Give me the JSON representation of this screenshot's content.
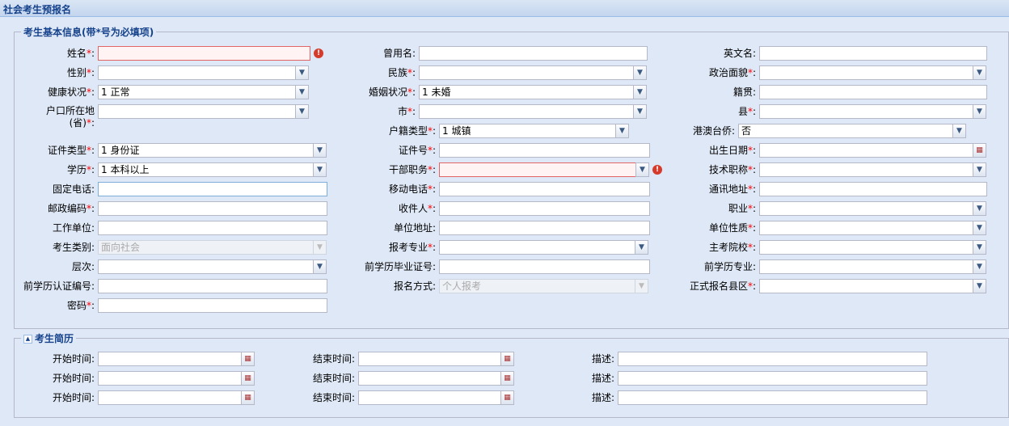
{
  "panel_title": "社会考生预报名",
  "basic": {
    "legend": "考生基本信息(带*号为必填项)",
    "req_mark": "*",
    "colon": ":",
    "fields": {
      "name": {
        "label": "姓名",
        "value": ""
      },
      "former_name": {
        "label": "曾用名",
        "value": ""
      },
      "english_name": {
        "label": "英文名",
        "value": ""
      },
      "gender": {
        "label": "性别",
        "value": ""
      },
      "ethnicity": {
        "label": "民族",
        "value": ""
      },
      "political": {
        "label": "政治面貌",
        "value": ""
      },
      "health": {
        "label": "健康状况",
        "value": "1 正常"
      },
      "marital": {
        "label": "婚姻状况",
        "value": "1 未婚"
      },
      "native_place": {
        "label": "籍贯",
        "value": ""
      },
      "hukou_line1": "户口所在地",
      "hukou_line2": "(省)",
      "hukou": {
        "value": ""
      },
      "city": {
        "label": "市",
        "value": ""
      },
      "county": {
        "label": "县",
        "value": ""
      },
      "hukou_type": {
        "label": "户籍类型",
        "value": "1 城镇"
      },
      "hmt": {
        "label": "港澳台侨",
        "value": "否"
      },
      "id_type": {
        "label": "证件类型",
        "value": "1 身份证"
      },
      "id_no": {
        "label": "证件号",
        "value": ""
      },
      "birth": {
        "label": "出生日期",
        "value": ""
      },
      "education": {
        "label": "学历",
        "value": "1 本科以上"
      },
      "cadre": {
        "label": "干部职务",
        "value": ""
      },
      "tech_title": {
        "label": "技术职称",
        "value": ""
      },
      "phone": {
        "label": "固定电话",
        "value": ""
      },
      "mobile": {
        "label": "移动电话",
        "value": ""
      },
      "address": {
        "label": "通讯地址",
        "value": ""
      },
      "postcode": {
        "label": "邮政编码",
        "value": ""
      },
      "recipient": {
        "label": "收件人",
        "value": ""
      },
      "occupation": {
        "label": "职业",
        "value": ""
      },
      "employer": {
        "label": "工作单位",
        "value": ""
      },
      "employer_addr": {
        "label": "单位地址",
        "value": ""
      },
      "employer_type": {
        "label": "单位性质",
        "value": ""
      },
      "category": {
        "label": "考生类别",
        "value": "面向社会"
      },
      "major": {
        "label": "报考专业",
        "value": ""
      },
      "school": {
        "label": "主考院校",
        "value": ""
      },
      "level": {
        "label": "层次",
        "value": ""
      },
      "prev_cert": {
        "label": "前学历毕业证号",
        "value": ""
      },
      "prev_major": {
        "label": "前学历专业",
        "value": ""
      },
      "prev_auth": {
        "label": "前学历认证编号",
        "value": ""
      },
      "reg_method": {
        "label": "报名方式",
        "value": "个人报考"
      },
      "formal_county": {
        "label": "正式报名县区",
        "value": ""
      },
      "password": {
        "label": "密码",
        "value": ""
      }
    }
  },
  "resume": {
    "legend": "考生简历",
    "collapse_glyph": "▲",
    "labels": {
      "start": "开始时间:",
      "end": "结束时间:",
      "desc": "描述:"
    },
    "rows": [
      {
        "start": "",
        "end": "",
        "desc": ""
      },
      {
        "start": "",
        "end": "",
        "desc": ""
      },
      {
        "start": "",
        "end": "",
        "desc": ""
      }
    ]
  },
  "icons": {
    "dropdown": "▼",
    "calendar": "▦",
    "error": "!"
  }
}
